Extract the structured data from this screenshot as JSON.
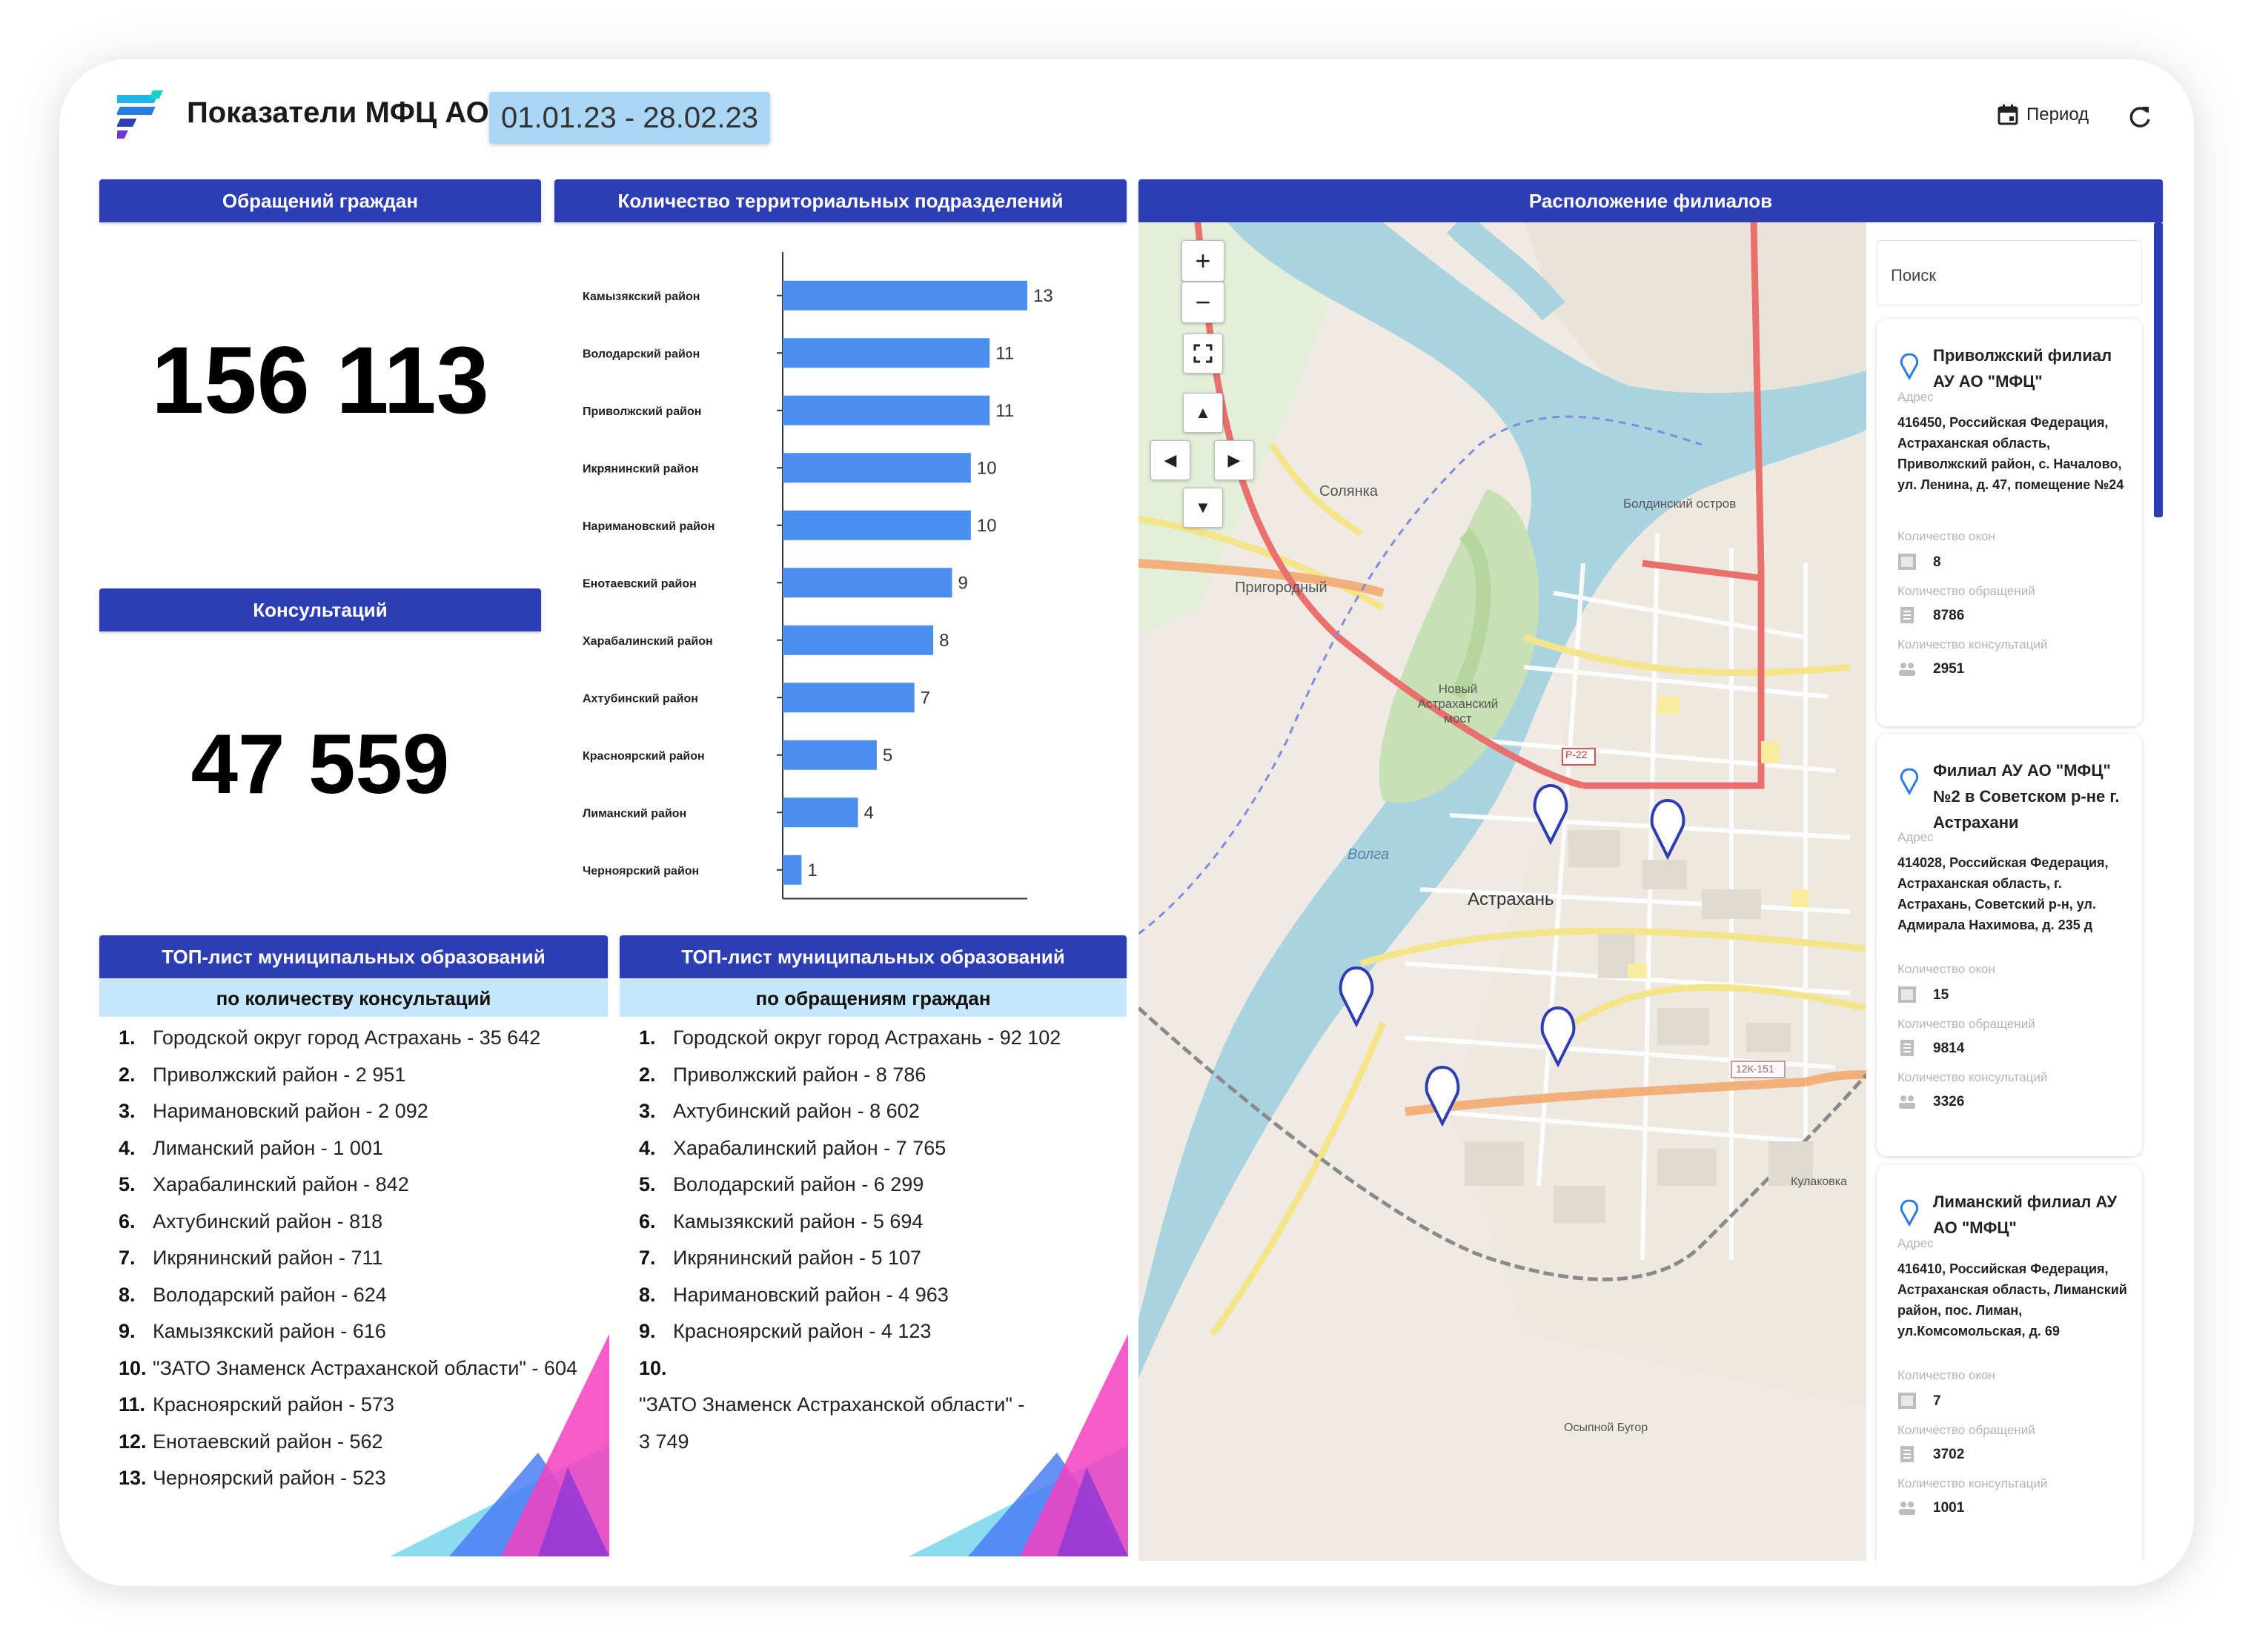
{
  "header": {
    "title": "Показатели МФЦ АО",
    "period": "01.01.23 - 28.02.23",
    "period_button": "Период"
  },
  "appeals": {
    "title": "Обращений граждан",
    "value": "156 113"
  },
  "consultations": {
    "title": "Консультаций",
    "value": "47 559"
  },
  "chart_data": {
    "type": "bar",
    "orientation": "horizontal",
    "title": "Количество территориальных подразделений",
    "categories": [
      "Камызякский район",
      "Володарский район",
      "Приволжский район",
      "Икрянинский район",
      "Наримановский район",
      "Енотаевский район",
      "Харабалинский район",
      "Ахтубинский район",
      "Красноярский район",
      "Лиманский район",
      "Черноярский район"
    ],
    "values": [
      13,
      11,
      11,
      10,
      10,
      9,
      8,
      7,
      5,
      4,
      1
    ],
    "xlim": [
      0,
      13
    ],
    "color": "#4a8ff0"
  },
  "top_consultations": {
    "title": "ТОП-лист муниципальных образований",
    "subtitle": "по количеству консультаций",
    "items": [
      "Городской округ город Астрахань - 35 642",
      "Приволжский район - 2 951",
      "Наримановский район - 2 092",
      "Лиманский район - 1 001",
      "Харабалинский район - 842",
      "Ахтубинский район - 818",
      "Икрянинский район - 711",
      "Володарский район - 624",
      "Камызякский район - 616",
      "\"ЗАТО Знаменск Астраханской области\" - 604",
      "Красноярский район - 573",
      "Енотаевский район - 562",
      "Черноярский район - 523"
    ]
  },
  "top_appeals": {
    "title": "ТОП-лист муниципальных образований",
    "subtitle": "по обращениям граждан",
    "items": [
      "Городской округ город Астрахань - 92 102",
      "Приволжский район - 8 786",
      "Ахтубинский район - 8 602",
      "Харабалинский район - 7 765",
      "Володарский район - 6 299",
      "Камызякский район - 5 694",
      "Икрянинский район - 5 107",
      "Наримановский район - 4 963",
      "Красноярский район - 4 123",
      "\"ЗАТО Знаменск Астраханской области\" - 3 749"
    ]
  },
  "map": {
    "title": "Расположение филиалов",
    "labels": {
      "city": "Астрахань",
      "river": "Волга",
      "solyanka": "Солянка",
      "prigorodny": "Пригородный",
      "bridge": "Новый Астраханский мост",
      "island": "Болдинский остров",
      "road1": "Р-22",
      "road2": "12К-151",
      "kulakovka": "Кулаковка",
      "ostrov": "Осыпной Бугор"
    },
    "zoom_in": "+",
    "zoom_out": "−"
  },
  "branches": {
    "search_placeholder": "Поиск",
    "labels": {
      "address": "Адрес",
      "windows": "Количество окон",
      "appeals": "Количество обращений",
      "consultations": "Количество консультаций"
    },
    "items": [
      {
        "name": "Приволжский филиал АУ АО \"МФЦ\"",
        "address": "416450, Российская Федерация, Астраханская область, Приволжский район, с. Началово, ул. Ленина, д. 47, помещение №24",
        "windows": "8",
        "appeals": "8786",
        "consultations": "2951"
      },
      {
        "name": "Филиал АУ АО \"МФЦ\" №2 в Советском р-не г. Астрахани",
        "address": "414028, Российская Федерация, Астраханская область, г. Астрахань, Советский р-н, ул. Адмирала Нахимова, д. 235 д",
        "windows": "15",
        "appeals": "9814",
        "consultations": "3326"
      },
      {
        "name": "Лиманский филиал АУ АО \"МФЦ\"",
        "address": "416410, Российская Федерация, Астраханская область, Лиманский район, пос. Лиман, ул.Комсомольская, д. 69",
        "windows": "7",
        "appeals": "3702",
        "consultations": "1001"
      }
    ]
  }
}
